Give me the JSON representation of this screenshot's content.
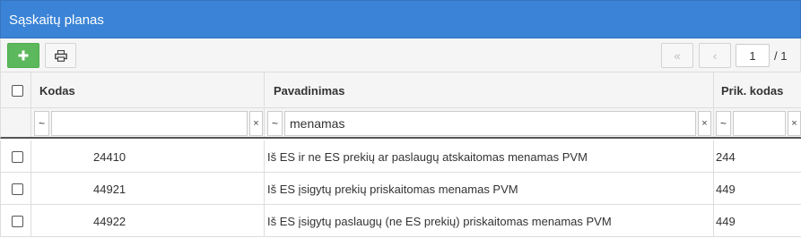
{
  "panel": {
    "title": "Sąskaitų planas"
  },
  "toolbar": {
    "add_icon": "plus-icon",
    "print_icon": "printer-icon",
    "first_label": "«",
    "prev_label": "‹",
    "page": "1",
    "total": "/ 1"
  },
  "columns": {
    "code": "Kodas",
    "name": "Pavadinimas",
    "prik_code": "Prik. kodas"
  },
  "filters": {
    "code_op": "~",
    "code_value": "",
    "name_op": "~",
    "name_value": "menamas",
    "prik_op": "~",
    "prik_value": "",
    "clear_label": "×"
  },
  "rows": [
    {
      "code": "24410",
      "name": "Iš ES ir ne ES prekių ar paslaugų atskaitomas menamas PVM",
      "prik_code": "244"
    },
    {
      "code": "44921",
      "name": "Iš ES įsigytų prekių priskaitomas menamas PVM",
      "prik_code": "449"
    },
    {
      "code": "44922",
      "name": "Iš ES įsigytų paslaugų (ne ES prekių) priskaitomas menamas PVM",
      "prik_code": "449"
    }
  ],
  "colors": {
    "title_bar": "#3a83d6",
    "add_button": "#5cb85c"
  }
}
